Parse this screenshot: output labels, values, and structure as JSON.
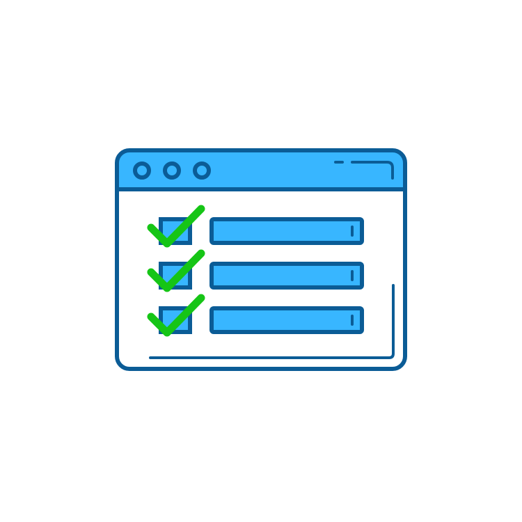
{
  "illustration": {
    "subject": "browser-window-checklist-icon",
    "window_dots": 3,
    "checklist": {
      "items": [
        {
          "checked": true
        },
        {
          "checked": true
        },
        {
          "checked": true
        }
      ]
    }
  },
  "colors": {
    "outline": "#0b5c96",
    "fill_blue": "#38b6ff",
    "window_body": "#ffffff",
    "check_green": "#16c516",
    "background": "#ffffff"
  }
}
